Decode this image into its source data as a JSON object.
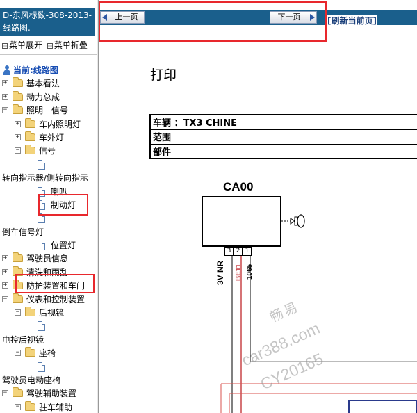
{
  "left_panel": {
    "title": "D-东风标致-308-2013- 线路图.",
    "menu": {
      "expand_label": "菜单展开",
      "collapse_label": "菜单折叠"
    },
    "tree": [
      {
        "label": "当前:线路图",
        "type": "root",
        "icon": "person-icon"
      },
      {
        "label": "基本看法",
        "type": "folder",
        "toggle": "+"
      },
      {
        "label": "动力总成",
        "type": "folder",
        "toggle": "+"
      },
      {
        "label": "照明—信号",
        "type": "folder",
        "toggle": "−"
      },
      {
        "label": "车内照明灯",
        "type": "folder",
        "toggle": "+"
      },
      {
        "label": "车外灯",
        "type": "folder",
        "toggle": "+"
      },
      {
        "label": "信号",
        "type": "folder",
        "toggle": "−"
      },
      {
        "label": "",
        "type": "page"
      },
      {
        "label": "转向指示器/侧转向指示",
        "type": "text"
      },
      {
        "label": "喇叭",
        "type": "page"
      },
      {
        "label": "制动灯",
        "type": "page"
      },
      {
        "label": "",
        "type": "page"
      },
      {
        "label": "倒车信号灯",
        "type": "text"
      },
      {
        "label": "位置灯",
        "type": "page"
      },
      {
        "label": "驾驶员信息",
        "type": "folder",
        "toggle": "+"
      },
      {
        "label": "清洗和雨刮",
        "type": "folder",
        "toggle": "+"
      },
      {
        "label": "防护装置和车门",
        "type": "folder",
        "toggle": "+"
      },
      {
        "label": "仪表和控制装置",
        "type": "folder",
        "toggle": "−"
      },
      {
        "label": "后视镜",
        "type": "folder",
        "toggle": "−"
      },
      {
        "label": "",
        "type": "page"
      },
      {
        "label": "电控后视镜",
        "type": "text"
      },
      {
        "label": "座椅",
        "type": "folder",
        "toggle": "−"
      },
      {
        "label": "",
        "type": "page"
      },
      {
        "label": "驾驶员电动座椅",
        "type": "text"
      },
      {
        "label": "驾驶辅助装置",
        "type": "folder",
        "toggle": "−"
      },
      {
        "label": "驻车辅助",
        "type": "folder",
        "toggle": "−"
      }
    ]
  },
  "nav": {
    "prev_label": "上一页",
    "next_label": "下一页",
    "refresh_label": "[刷新当前页]"
  },
  "document": {
    "title": "打印",
    "info_rows": [
      {
        "label": "车辆",
        "value": "：TX3 CHINE"
      },
      {
        "label": "范围",
        "value": ""
      },
      {
        "label": "部件",
        "value": ""
      }
    ],
    "connector": {
      "name": "CA00",
      "pins": [
        "3",
        "2",
        "1"
      ],
      "wires": [
        {
          "label": "3V NR",
          "color": "#000000"
        },
        {
          "label": "BE11",
          "color": "#c0282d"
        },
        {
          "label": "1065",
          "color": "#000000"
        }
      ]
    },
    "watermark": [
      "畅易",
      "car388.com",
      "CY20165"
    ]
  },
  "colors": {
    "header_blue": "#1a5f8c",
    "highlight_red": "#e8282d",
    "diagram_red": "#d9534f"
  }
}
